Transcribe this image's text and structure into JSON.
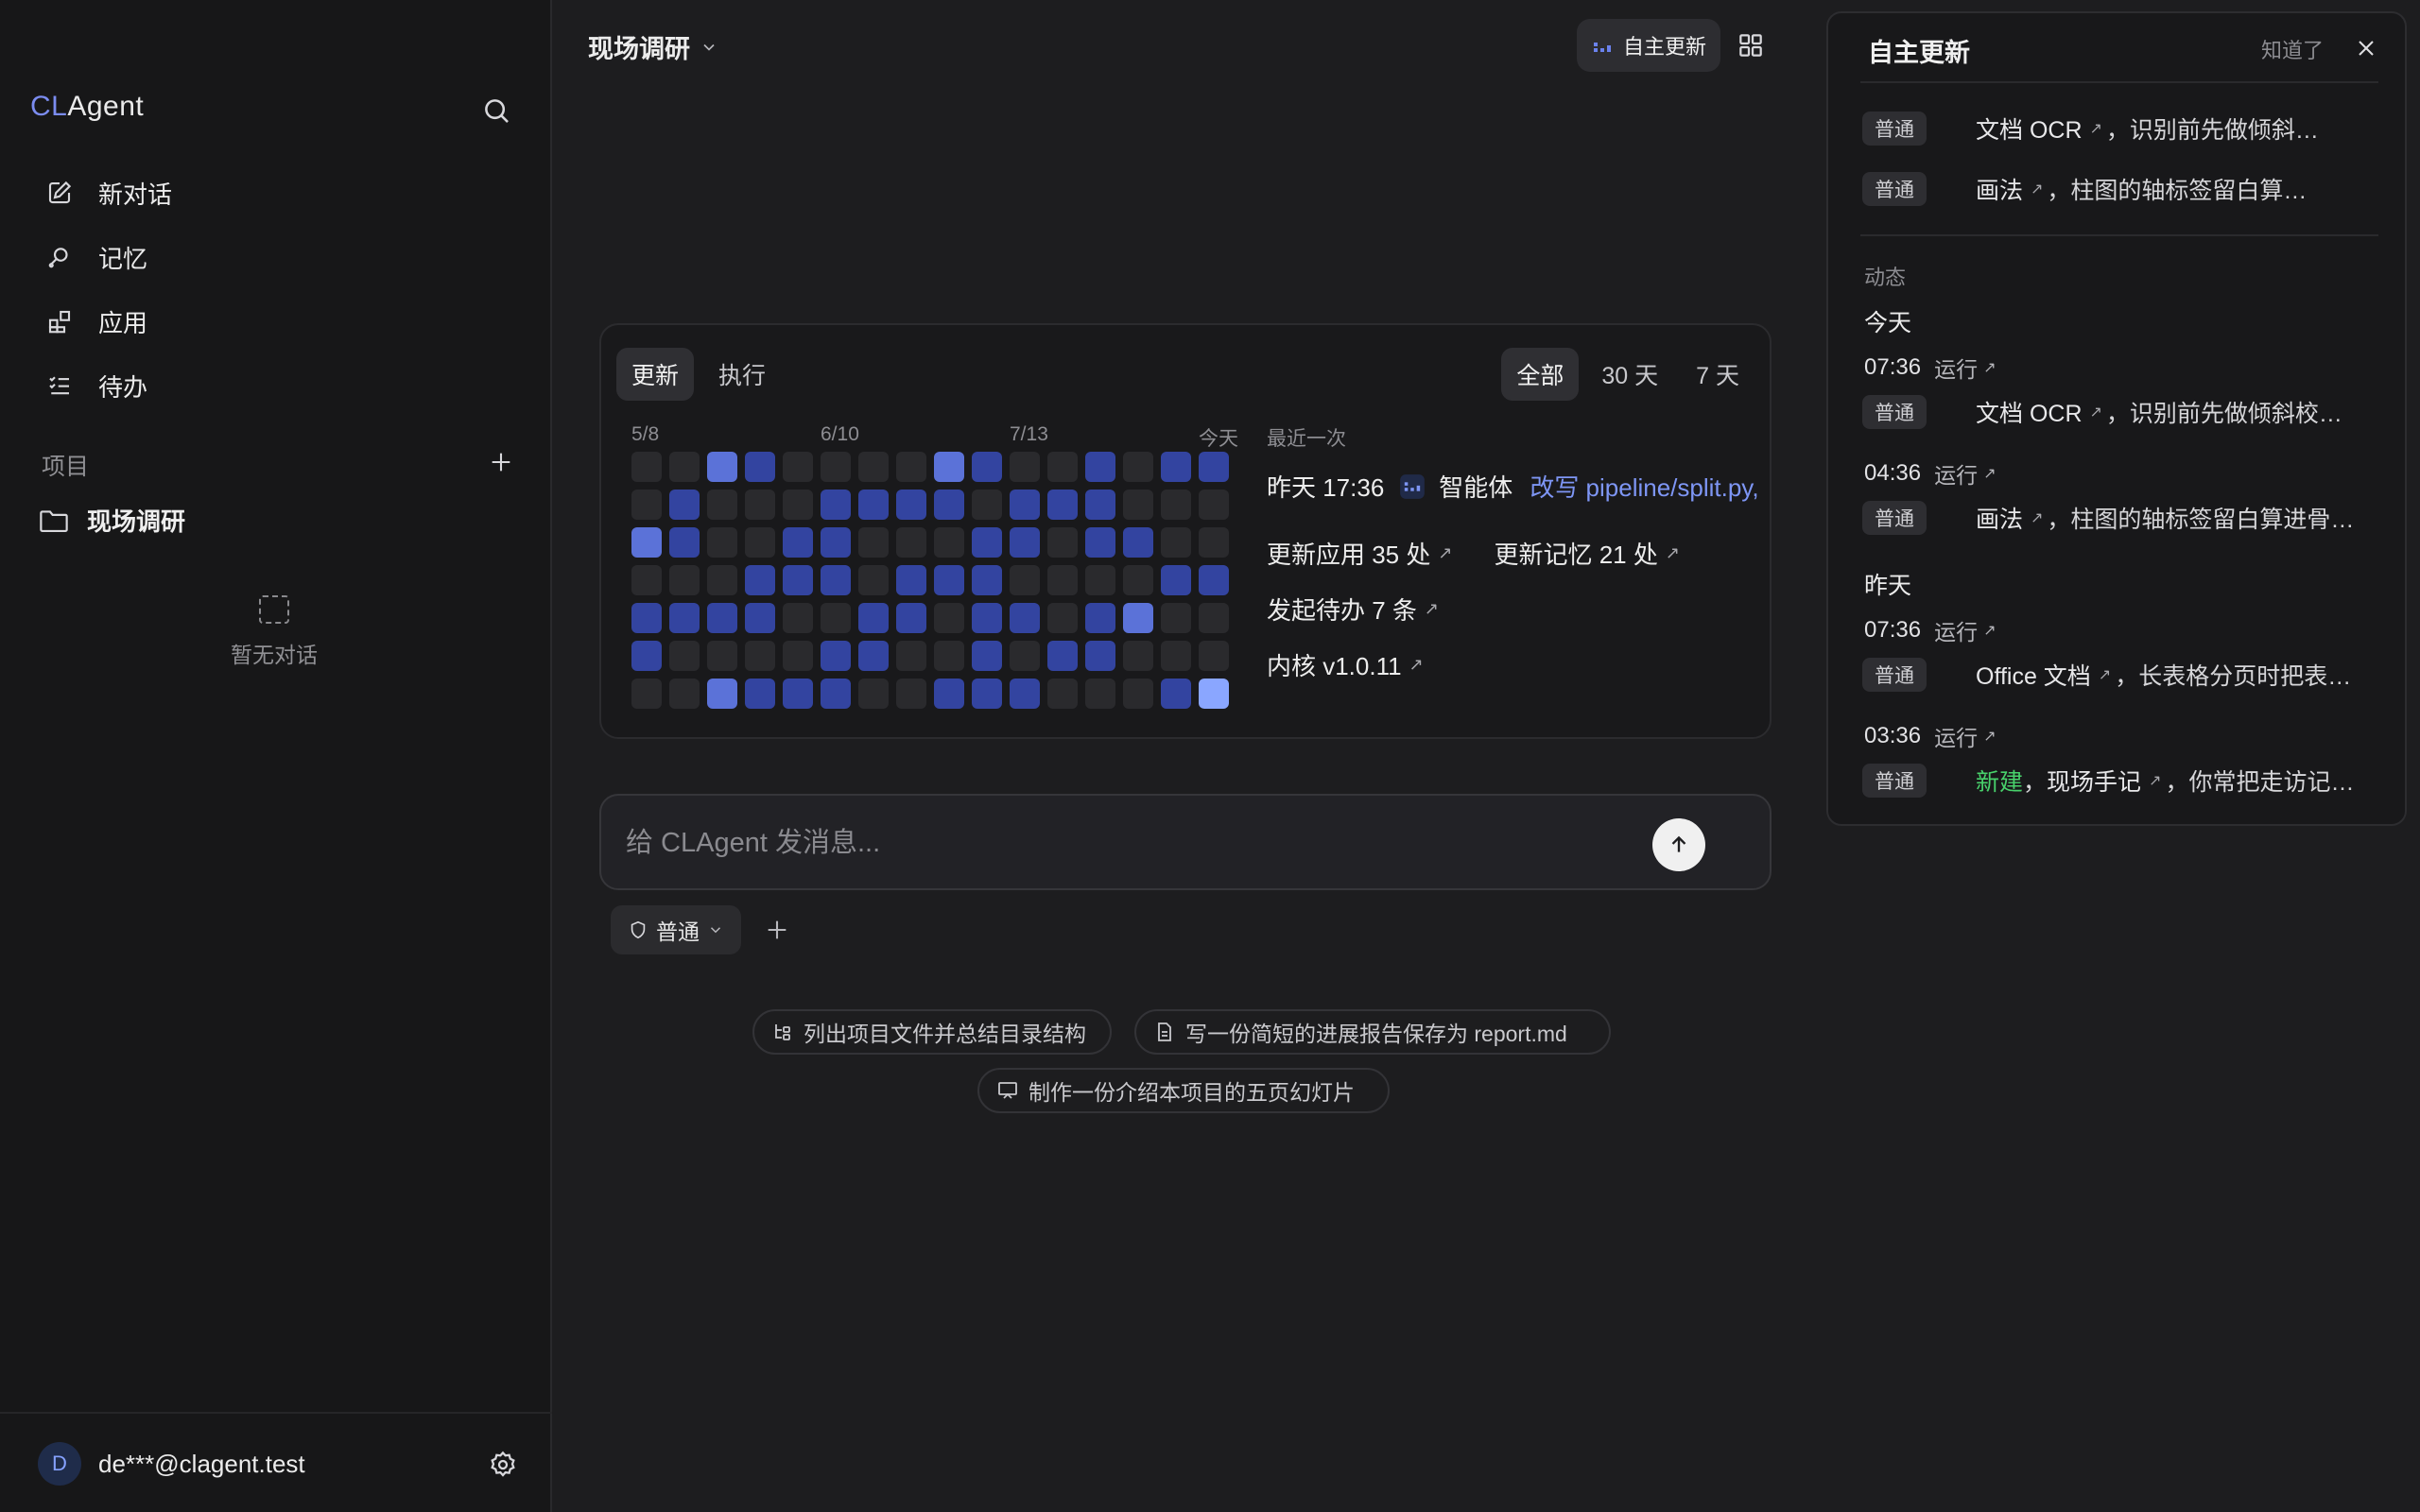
{
  "sidebar": {
    "logo_cl": "CL",
    "logo_agent": "Agent",
    "nav": [
      {
        "label": "新对话",
        "icon": "edit-icon"
      },
      {
        "label": "记忆",
        "icon": "memory-icon"
      },
      {
        "label": "应用",
        "icon": "apps-icon"
      },
      {
        "label": "待办",
        "icon": "todo-icon"
      }
    ],
    "projects_label": "项目",
    "project_name": "现场调研",
    "empty_label": "暂无对话",
    "user_initial": "D",
    "user_email": "de***@clagent.test"
  },
  "header": {
    "title": "现场调研",
    "auto_update_label": "自主更新"
  },
  "activity": {
    "tabs": [
      "更新",
      "执行"
    ],
    "active_tab": 0,
    "ranges": [
      "全部",
      "30 天",
      "7 天"
    ],
    "active_range": 0,
    "month_labels": [
      "5/8",
      "6/10",
      "7/13",
      "今天"
    ],
    "heatmap_levels": [
      [
        0,
        0,
        3,
        1,
        0,
        0,
        0,
        0,
        3,
        1,
        0,
        0,
        1,
        0,
        1,
        1
      ],
      [
        0,
        1,
        0,
        0,
        0,
        1,
        1,
        1,
        1,
        0,
        1,
        1,
        1,
        0,
        0,
        0
      ],
      [
        3,
        1,
        0,
        0,
        1,
        1,
        0,
        0,
        0,
        1,
        1,
        0,
        1,
        1,
        0,
        0
      ],
      [
        0,
        0,
        0,
        1,
        1,
        1,
        0,
        1,
        1,
        1,
        0,
        0,
        0,
        0,
        1,
        1
      ],
      [
        1,
        1,
        1,
        1,
        0,
        0,
        1,
        1,
        0,
        1,
        1,
        0,
        1,
        3,
        0,
        0
      ],
      [
        1,
        0,
        0,
        0,
        0,
        1,
        1,
        0,
        0,
        1,
        0,
        1,
        1,
        0,
        0,
        0
      ],
      [
        0,
        0,
        3,
        1,
        1,
        1,
        0,
        0,
        1,
        1,
        1,
        0,
        0,
        0,
        1,
        4
      ]
    ],
    "heat_colors": [
      "#2a2a2d",
      "#3344a0",
      "#4a5fc6",
      "#5b72d8",
      "#8aa6ff"
    ],
    "recent_label": "最近一次",
    "recent_time": "昨天 17:36",
    "recent_agent": "智能体",
    "recent_action": "改写 pipeline/split.py,",
    "stats": {
      "apps": "更新应用 35 处",
      "memory": "更新记忆 21 处",
      "todos": "发起待办 7 条",
      "kernel": "内核 v1.0.11"
    }
  },
  "composer": {
    "placeholder": "给 CLAgent 发消息...",
    "mode": "普通"
  },
  "suggestions": [
    "列出项目文件并总结目录结构",
    "写一份简短的进展报告保存为 report.md",
    "制作一份介绍本项目的五页幻灯片"
  ],
  "panel": {
    "title": "自主更新",
    "dismiss": "知道了",
    "pinned": [
      {
        "badge": "普通",
        "name": "文档 OCR",
        "rest": "，识别前先做倾斜…"
      },
      {
        "badge": "普通",
        "name": "画法",
        "rest": "，柱图的轴标签留白算…"
      }
    ],
    "feed_label": "动态",
    "today_label": "今天",
    "yesterday_label": "昨天",
    "run_label": "运行",
    "today": [
      {
        "time": "07:36",
        "badge": "普通",
        "name": "文档 OCR",
        "rest": "，识别前先做倾斜校…"
      },
      {
        "time": "04:36",
        "badge": "普通",
        "name": "画法",
        "rest": "，柱图的轴标签留白算进骨…"
      }
    ],
    "yesterday": [
      {
        "time": "07:36",
        "badge": "普通",
        "name": "Office 文档",
        "rest": "，长表格分页时把表…"
      },
      {
        "time": "03:36",
        "badge": "普通",
        "prefix": "新建",
        "name": "现场手记",
        "rest": "，你常把走访记…"
      }
    ]
  }
}
